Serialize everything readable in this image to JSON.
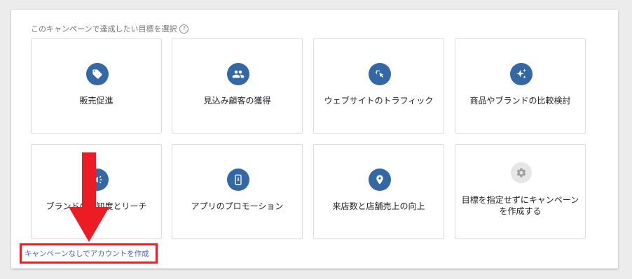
{
  "header": {
    "title": "このキャンペーンで達成したい目標を選択",
    "help_icon": "?"
  },
  "goals": [
    {
      "label": "販売促進",
      "icon": "tag-icon"
    },
    {
      "label": "見込み顧客の獲得",
      "icon": "people-icon"
    },
    {
      "label": "ウェブサイトのトラフィック",
      "icon": "cursor-click-icon"
    },
    {
      "label": "商品やブランドの比較検討",
      "icon": "sparkle-icon"
    },
    {
      "label": "ブランドの認知度とリーチ",
      "icon": "megaphone-icon"
    },
    {
      "label": "アプリのプロモーション",
      "icon": "phone-download-icon"
    },
    {
      "label": "来店数と店舗売上の向上",
      "icon": "location-pin-icon"
    },
    {
      "label": "目標を指定せずにキャンペーンを作成する",
      "icon": "gear-icon"
    }
  ],
  "footer": {
    "no_campaign_link": "キャンペーンなしでアカウントを作成"
  },
  "colors": {
    "icon_bg": "#3367a6",
    "icon_disabled_bg": "#e6e6e6",
    "highlight": "#e8202a",
    "link": "#4a66c4"
  }
}
